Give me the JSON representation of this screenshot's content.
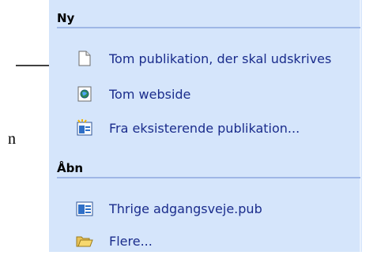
{
  "outside": {
    "letter": "n"
  },
  "sections": [
    {
      "title": "Ny"
    },
    {
      "title": "Åbn"
    }
  ],
  "new_items": [
    {
      "label": "Tom publikation, der skal udskrives",
      "icon": "blank-page-icon"
    },
    {
      "label": "Tom webside",
      "icon": "web-page-icon"
    },
    {
      "label": "Fra eksisterende publikation...",
      "icon": "publisher-wizard-icon"
    }
  ],
  "open_items": [
    {
      "label": "Thrige adgangsveje.pub",
      "icon": "publisher-file-icon"
    },
    {
      "label": "Flere...",
      "icon": "open-folder-icon"
    }
  ],
  "colors": {
    "pane_background": "#d5e5fb",
    "link_text": "#1a2c8c",
    "header_rule": "#9fb7e6"
  }
}
